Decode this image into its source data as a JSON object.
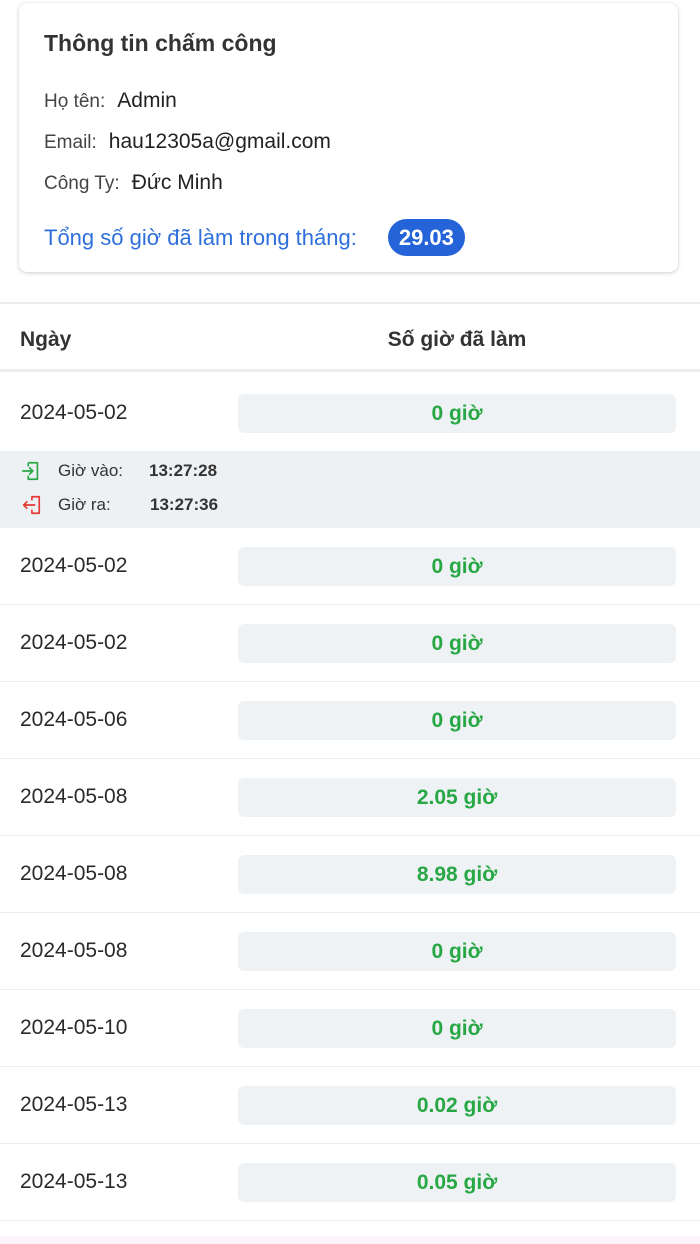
{
  "card": {
    "title": "Thông tin chấm công",
    "name_label": "Họ tên:",
    "name_value": "Admin",
    "email_label": "Email:",
    "email_value": "hau12305a@gmail.com",
    "company_label": "Công Ty:",
    "company_value": "Đức Minh",
    "total_label": "Tổng số giờ đã làm trong tháng:",
    "total_value": "29.03"
  },
  "table": {
    "col_date": "Ngày",
    "col_hours": "Số giờ đã làm",
    "rows": [
      {
        "date": "2024-05-02",
        "hours": "0 giờ"
      },
      {
        "date": "2024-05-02",
        "hours": "0 giờ"
      },
      {
        "date": "2024-05-02",
        "hours": "0 giờ"
      },
      {
        "date": "2024-05-06",
        "hours": "0 giờ"
      },
      {
        "date": "2024-05-08",
        "hours": "2.05 giờ"
      },
      {
        "date": "2024-05-08",
        "hours": "8.98 giờ"
      },
      {
        "date": "2024-05-08",
        "hours": "0 giờ"
      },
      {
        "date": "2024-05-10",
        "hours": "0 giờ"
      },
      {
        "date": "2024-05-13",
        "hours": "0.02 giờ"
      },
      {
        "date": "2024-05-13",
        "hours": "0.05 giờ"
      }
    ],
    "detail": {
      "in_label": "Giờ vào:",
      "in_time": "13:27:28",
      "out_label": "Giờ ra:",
      "out_time": "13:27:36"
    }
  },
  "colors": {
    "accent_blue": "#2563d8",
    "hours_green": "#28a745",
    "checkin_icon": "#28a745",
    "checkout_icon": "#e53935"
  },
  "icons": {
    "checkin": "login-icon",
    "checkout": "logout-icon"
  }
}
